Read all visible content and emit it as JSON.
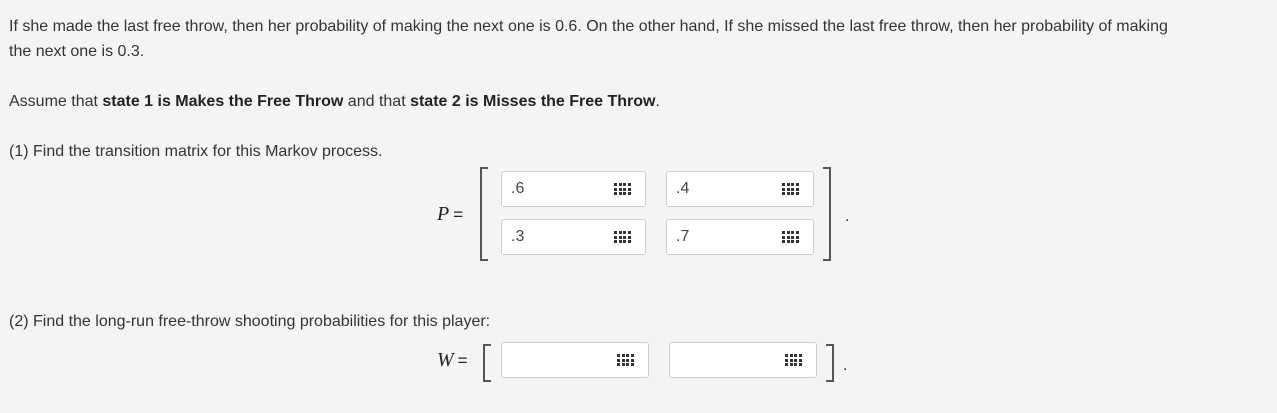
{
  "intro": {
    "line1": "If she made the last free throw, then her probability of making the next one is 0.6. On the other hand, If she missed the last free throw, then her probability of making",
    "line2": "the next one is 0.3."
  },
  "assume": {
    "prefix": "Assume that ",
    "state1": "state 1 is Makes the Free Throw",
    "middle": " and that ",
    "state2": "state 2 is Misses the Free Throw",
    "suffix": "."
  },
  "question1": {
    "text": "(1) Find the transition matrix for this Markov process.",
    "label": "P",
    "equals": "=",
    "cells": [
      {
        "value": ".6"
      },
      {
        "value": ".4"
      },
      {
        "value": ".3"
      },
      {
        "value": ".7"
      }
    ],
    "trailing_period": "."
  },
  "question2": {
    "text": "(2) Find the long-run free-throw shooting probabilities for this player:",
    "label": "W",
    "equals": "=",
    "cells": [
      {
        "value": ""
      },
      {
        "value": ""
      }
    ],
    "trailing_period": "."
  },
  "icons": {
    "matrix_palette": "grid-keypad-icon"
  }
}
